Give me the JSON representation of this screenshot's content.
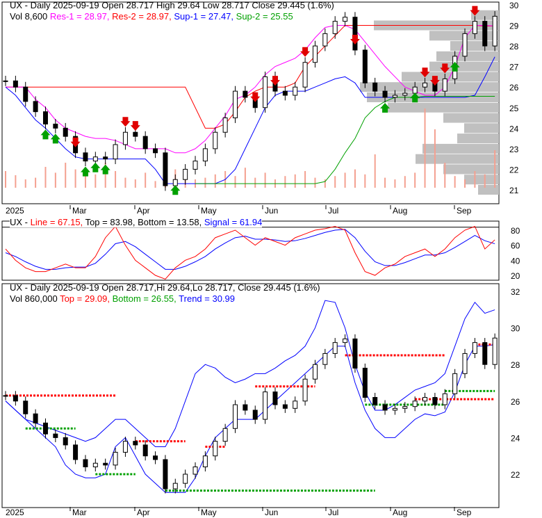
{
  "header1": {
    "line1": "UX - Daily 2025-09-19 Open 28.717  High 29.64  Low 28.717  Close 29.445 (1.6%)",
    "vol": "Vol 8,600",
    "res1": "Res-1 = 28.97,",
    "res2": "Res-2 = 28.97,",
    "sup1": "Sup-1 = 27.47,",
    "sup2": "Sup-2 = 25.55"
  },
  "header2": {
    "ux": "UX -",
    "line": "Line = 67.15,",
    "top": "Top = 83.98,",
    "bottom": "Bottom = 13.58,",
    "signal": "Signal = 61.94"
  },
  "header3": {
    "line1": "UX - Daily 2025-09-19 Open 28.717,Hi 29.64,Lo 28.717, Close 29.445 (1.6%)",
    "vol": "Vol 860,000",
    "top": "Top = 29.09,",
    "bottom": "Bottom = 26.55,",
    "trend": "Trend = 30.99"
  },
  "colors": {
    "up": "#000000",
    "res1": "#ff00ff",
    "res2": "#ff0000",
    "sup1": "#0000ff",
    "sup2": "#00a000",
    "volume": "#f4a090",
    "profile": "#c0c0c0"
  },
  "x_labels": [
    "2025",
    "Mar",
    "Apr",
    "May",
    "Jun",
    "Jul",
    "Aug",
    "Sep"
  ],
  "chart_data": [
    {
      "type": "candlestick",
      "title": "UX - Daily",
      "ylim": [
        20.5,
        30.3
      ],
      "yticks": [
        21,
        22,
        23,
        24,
        25,
        26,
        27,
        28,
        29,
        30
      ],
      "close": [
        26.3,
        26.0,
        25.3,
        24.8,
        24.2,
        24.0,
        23.6,
        22.8,
        22.4,
        22.6,
        22.5,
        23.2,
        23.8,
        23.6,
        23.0,
        22.8,
        21.2,
        21.5,
        22.0,
        22.4,
        23.0,
        23.8,
        24.5,
        25.8,
        25.5,
        25.0,
        26.5,
        25.8,
        25.6,
        26.0,
        27.2,
        28.0,
        28.6,
        29.2,
        29.4,
        27.8,
        26.2,
        25.8,
        25.5,
        25.6,
        25.7,
        26.0,
        26.2,
        25.8,
        26.4,
        27.5,
        28.6,
        29.2,
        28.0,
        29.445
      ],
      "volume": [
        20,
        15,
        10,
        12,
        25,
        18,
        30,
        22,
        14,
        16,
        30,
        20,
        12,
        10,
        18,
        8,
        35,
        22,
        14,
        10,
        12,
        16,
        20,
        14,
        24,
        12,
        18,
        10,
        14,
        16,
        20,
        12,
        10,
        14,
        18,
        22,
        16,
        40,
        12,
        10,
        14,
        18,
        95,
        70,
        30,
        14,
        10,
        20,
        16,
        45
      ],
      "res1": [
        26,
        26,
        26,
        25.4,
        25,
        24.4,
        24,
        23.8,
        23.6,
        23.5,
        23.5,
        23.4,
        23.2,
        23,
        23,
        23,
        23,
        22.8,
        22.8,
        23,
        23.4,
        24,
        24.6,
        25.4,
        25.6,
        26,
        26.6,
        27,
        27.2,
        27.4,
        27.8,
        28.4,
        28.9,
        29,
        29,
        28.8,
        28.2,
        27.6,
        27,
        26.5,
        26,
        25.8,
        25.6,
        25.6,
        26,
        27,
        28.4,
        29,
        29,
        28.97
      ],
      "res2": [
        26,
        26,
        26,
        26,
        26,
        26,
        26,
        26,
        26,
        26,
        26,
        26,
        26,
        26,
        26,
        26,
        26,
        26,
        26,
        25,
        24,
        24,
        24.2,
        24.8,
        25.5,
        25.8,
        26,
        26,
        26,
        26.2,
        27,
        27.5,
        28,
        28.5,
        29,
        29,
        29,
        29,
        29,
        29,
        29,
        29,
        29,
        29,
        29,
        29,
        29,
        29,
        28.97,
        28.97
      ],
      "sup1": [
        26,
        25.6,
        25,
        24.4,
        24,
        23.5,
        23,
        22.6,
        22.5,
        22.5,
        22.5,
        22.5,
        22.5,
        22.5,
        22.5,
        22,
        21.3,
        21.3,
        21.3,
        21.3,
        21.3,
        21.3,
        21.5,
        22,
        23,
        24,
        25,
        25.6,
        25.8,
        25.8,
        25.8,
        26,
        26.2,
        26.4,
        26.5,
        26.2,
        25.5,
        25.5,
        25.5,
        25.5,
        25.5,
        25.5,
        25.5,
        25.5,
        25.5,
        25.5,
        25.5,
        25.6,
        26.5,
        27.47
      ],
      "sup2": [
        null,
        null,
        null,
        null,
        null,
        null,
        null,
        null,
        null,
        null,
        null,
        null,
        null,
        null,
        null,
        null,
        null,
        null,
        null,
        21.3,
        21.3,
        21.3,
        21.3,
        21.3,
        21.3,
        21.3,
        21.3,
        21.3,
        21.3,
        21.3,
        21.3,
        21.3,
        21.4,
        22,
        22.8,
        23.5,
        24.5,
        25,
        25.3,
        25.5,
        25.5,
        25.5,
        25.55,
        25.55,
        25.55,
        25.55,
        25.55,
        25.55,
        25.55,
        25.55
      ],
      "down_arrows": [
        7,
        12,
        13,
        25,
        27,
        30,
        35,
        42,
        43,
        44,
        47
      ],
      "up_arrows": [
        4,
        5,
        8,
        9,
        10,
        17,
        38,
        41,
        45
      ],
      "volume_profile": [
        [
          21,
          0.15
        ],
        [
          21.5,
          0.25
        ],
        [
          22,
          0.4
        ],
        [
          22.5,
          0.6
        ],
        [
          23,
          0.55
        ],
        [
          23.5,
          0.3
        ],
        [
          24,
          0.25
        ],
        [
          24.5,
          0.4
        ],
        [
          25,
          0.8
        ],
        [
          25.5,
          0.95
        ],
        [
          26,
          1.0
        ],
        [
          26.5,
          0.7
        ],
        [
          27,
          0.5
        ],
        [
          27.5,
          0.45
        ],
        [
          28,
          0.35
        ],
        [
          28.5,
          0.5
        ],
        [
          29,
          0.9
        ],
        [
          29.5,
          0.2
        ]
      ]
    },
    {
      "type": "line",
      "ylim": [
        0,
        100
      ],
      "yticks": [
        20,
        40,
        60,
        80
      ],
      "top": 83.98,
      "bottom": 13.58,
      "line": [
        55,
        40,
        30,
        25,
        25,
        30,
        35,
        30,
        30,
        45,
        70,
        85,
        60,
        40,
        30,
        20,
        15,
        30,
        40,
        45,
        55,
        70,
        75,
        80,
        70,
        60,
        70,
        65,
        60,
        70,
        75,
        80,
        82,
        85,
        80,
        50,
        25,
        20,
        30,
        35,
        45,
        50,
        55,
        45,
        55,
        70,
        80,
        85,
        55,
        67.15
      ],
      "signal": [
        50,
        45,
        38,
        32,
        28,
        28,
        30,
        31,
        31,
        36,
        48,
        62,
        65,
        58,
        48,
        38,
        28,
        28,
        32,
        38,
        45,
        55,
        63,
        70,
        72,
        68,
        68,
        67,
        65,
        66,
        69,
        73,
        77,
        80,
        81,
        70,
        52,
        38,
        33,
        33,
        37,
        42,
        47,
        47,
        50,
        57,
        65,
        73,
        66,
        61.94
      ]
    },
    {
      "type": "candlestick",
      "ylim": [
        20.7,
        32.5
      ],
      "yticks": [
        22,
        24,
        26,
        28,
        30,
        32
      ],
      "top": 29.09,
      "bottom": 26.55,
      "trend": 30.99,
      "band_upper": [
        26,
        25.5,
        25,
        24.8,
        24.6,
        24.4,
        24.2,
        24,
        23.8,
        24,
        24.5,
        25,
        25,
        24.5,
        24,
        23.5,
        23.5,
        24.5,
        26,
        27.5,
        28,
        27.8,
        27.3,
        27,
        27.2,
        27.5,
        27.5,
        27.8,
        28.2,
        28.5,
        29,
        30,
        31.5,
        31.4,
        30,
        28,
        26.5,
        25.5,
        25.5,
        25.8,
        26.2,
        26.6,
        26.8,
        27,
        27.5,
        29,
        30.5,
        31.4,
        30.8,
        30.99
      ],
      "band_lower": [
        26,
        25.5,
        25,
        24.5,
        24,
        23.5,
        22.5,
        22,
        21.8,
        21.8,
        22,
        23.5,
        24,
        23,
        22,
        21.5,
        21,
        21,
        21,
        21.8,
        23,
        24,
        24.5,
        25,
        25,
        25,
        25.5,
        26,
        26.5,
        27,
        27.5,
        28,
        28.5,
        29,
        29,
        27,
        25.5,
        24.5,
        24,
        24,
        24.5,
        25,
        25.3,
        25.2,
        25.4,
        26.5,
        28,
        29,
        29,
        29.09
      ],
      "levels": [
        [
          0,
          11,
          26.3,
          "#ff0000"
        ],
        [
          2,
          7,
          24.5,
          "#00a000"
        ],
        [
          13,
          18,
          23.8,
          "#ff0000"
        ],
        [
          9,
          13,
          22,
          "#00a000"
        ],
        [
          16,
          37,
          21.1,
          "#00a000"
        ],
        [
          20,
          22,
          23.5,
          "#ff0000"
        ],
        [
          25,
          31,
          26.8,
          "#ff0000"
        ],
        [
          34,
          44,
          28.5,
          "#ff0000"
        ],
        [
          36,
          44,
          25.8,
          "#00a000"
        ],
        [
          41,
          49,
          26.1,
          "#ff0000"
        ],
        [
          44,
          49,
          26.55,
          "#00a000"
        ],
        [
          47,
          49,
          29.09,
          "#ff0000"
        ]
      ]
    }
  ]
}
